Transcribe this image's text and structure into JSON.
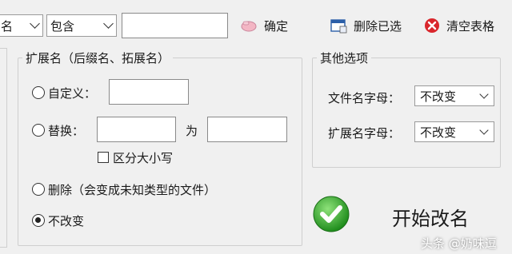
{
  "toolbar": {
    "field_combo_value": "名",
    "match_combo_value": "包含",
    "match_text_value": "",
    "confirm_label": "确定",
    "delete_selected_label": "删除已选",
    "clear_table_label": "清空表格"
  },
  "extension_group": {
    "title": "扩展名（后缀名、拓展名）",
    "custom_label": "自定义：",
    "custom_value": "",
    "replace_label": "替换：",
    "replace_from_value": "",
    "replace_to_label": "为",
    "replace_to_value": "",
    "case_sensitive_label": "区分大小写",
    "delete_label": "删除（会变成未知类型的文件）",
    "unchanged_label": "不改变",
    "selected_option": "unchanged"
  },
  "other_group": {
    "title": "其他选项",
    "filename_case_label": "文件名字母：",
    "filename_case_value": "不改变",
    "extension_case_label": "扩展名字母：",
    "extension_case_value": "不改变"
  },
  "start_button": {
    "label": "开始改名"
  },
  "watermark": {
    "text": "头条 @奶味逗"
  },
  "colors": {
    "window_bg": "#f0f0f0",
    "clear_icon_red": "#d9262c",
    "start_icon_green": "#2fa52a",
    "confirm_icon_pink": "#f3b6c4"
  }
}
